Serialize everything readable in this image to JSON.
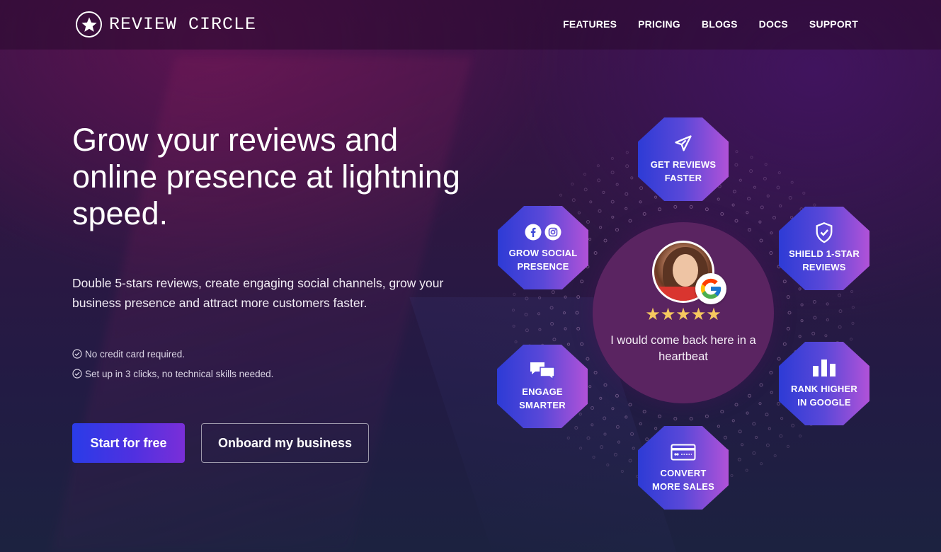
{
  "brand": {
    "name": "REVIEW CIRCLE",
    "logo_icon": "star-circle-icon"
  },
  "nav": {
    "items": [
      {
        "label": "FEATURES"
      },
      {
        "label": "PRICING"
      },
      {
        "label": "BLOGS"
      },
      {
        "label": "DOCS"
      },
      {
        "label": "SUPPORT"
      }
    ]
  },
  "hero": {
    "headline": "Grow your reviews and online presence at lightning speed.",
    "subtext": "Double 5-stars reviews, create engaging social channels, grow your business presence and attract more customers faster.",
    "checks": [
      {
        "text": "No credit card required.",
        "icon": "check-circle-icon"
      },
      {
        "text": "Set up in 3 clicks, no technical skills needed.",
        "icon": "check-circle-icon"
      }
    ],
    "primary_button": "Start for free",
    "secondary_button": "Onboard my business"
  },
  "review_card": {
    "stars": "★★★★★",
    "rating": 5,
    "quote": "I would come back here in a heartbeat",
    "badge_icon": "google-icon"
  },
  "features": [
    {
      "label": "GET REVIEWS\nFASTER",
      "icon": "paper-plane-icon"
    },
    {
      "label": "SHIELD 1-STAR\nREVIEWS",
      "icon": "shield-check-icon"
    },
    {
      "label": "RANK HIGHER\nIN GOOGLE",
      "icon": "bar-chart-icon"
    },
    {
      "label": "CONVERT\nMORE SALES",
      "icon": "credit-card-icon"
    },
    {
      "label": "ENGAGE\nSMARTER",
      "icon": "chat-bubbles-icon"
    },
    {
      "label": "GROW SOCIAL\nPRESENCE",
      "icon": "facebook-instagram-icon"
    }
  ],
  "colors": {
    "accent_gradient_start": "#2a3ce8",
    "accent_gradient_end": "#7a2fd8",
    "star_color": "#f6c85f",
    "center_circle": "#5a2461"
  }
}
